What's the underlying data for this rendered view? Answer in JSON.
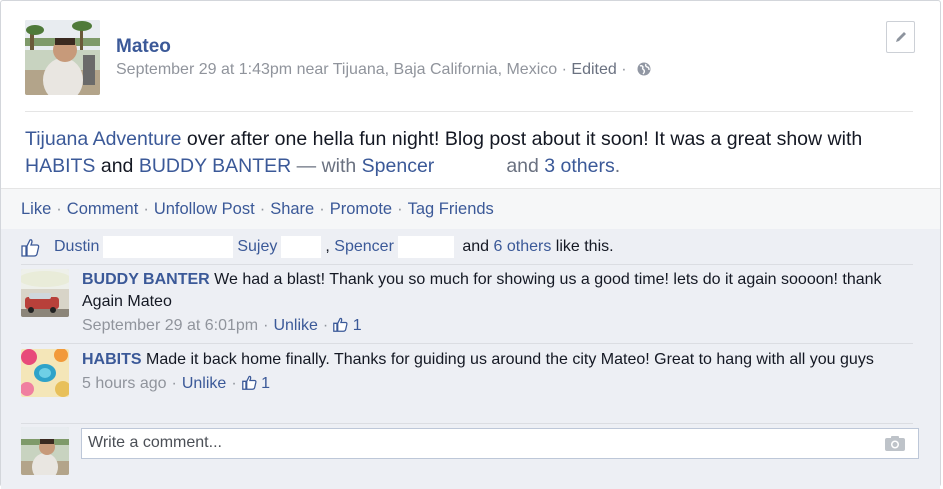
{
  "post": {
    "author": "Mateo",
    "timestamp": "September 29 at 1:43pm",
    "location_prefix": "near",
    "location": "Tijuana, Baja California, Mexico",
    "sep": "·",
    "edited": "Edited",
    "privacy_icon": "globe-icon",
    "text": {
      "page_link": "Tijuana Adventure",
      "body1": " over after one hella fun night! Blog post about it soon! It was a great show with ",
      "tag1": "HABITS",
      "and": " and ",
      "tag2": "BUDDY BANTER",
      "with": " — with ",
      "friend": "Spencer",
      "and2": "and ",
      "others": "3 others",
      "dot": "."
    }
  },
  "actions": {
    "like": "Like",
    "comment": "Comment",
    "unfollow": "Unfollow Post",
    "share": "Share",
    "promote": "Promote",
    "tag_friends": "Tag Friends",
    "sep": "·"
  },
  "likes": {
    "name1": "Dustin",
    "name2": "Sujey",
    "name3": "Spencer",
    "comma": ",",
    "and": "and",
    "others": "6 others",
    "suffix": "like this."
  },
  "comments": [
    {
      "author": "BUDDY BANTER",
      "text": "We had a blast! Thank you so much for showing us a good time! lets do it again soooon! thank Again Mateo",
      "time": "September 29 at 6:01pm",
      "action": "Unlike",
      "likes": "1",
      "sep": "·"
    },
    {
      "author": "HABITS",
      "text": "Made it back home finally. Thanks for guiding us around the city Mateo! Great to hang with all you guys",
      "time": "5 hours ago",
      "action": "Unlike",
      "likes": "1",
      "sep": "·"
    }
  ],
  "composer": {
    "placeholder": "Write a comment..."
  },
  "colors": {
    "link": "#3b5998",
    "muted": "#90949c",
    "feedback_bg": "#edeff4"
  }
}
